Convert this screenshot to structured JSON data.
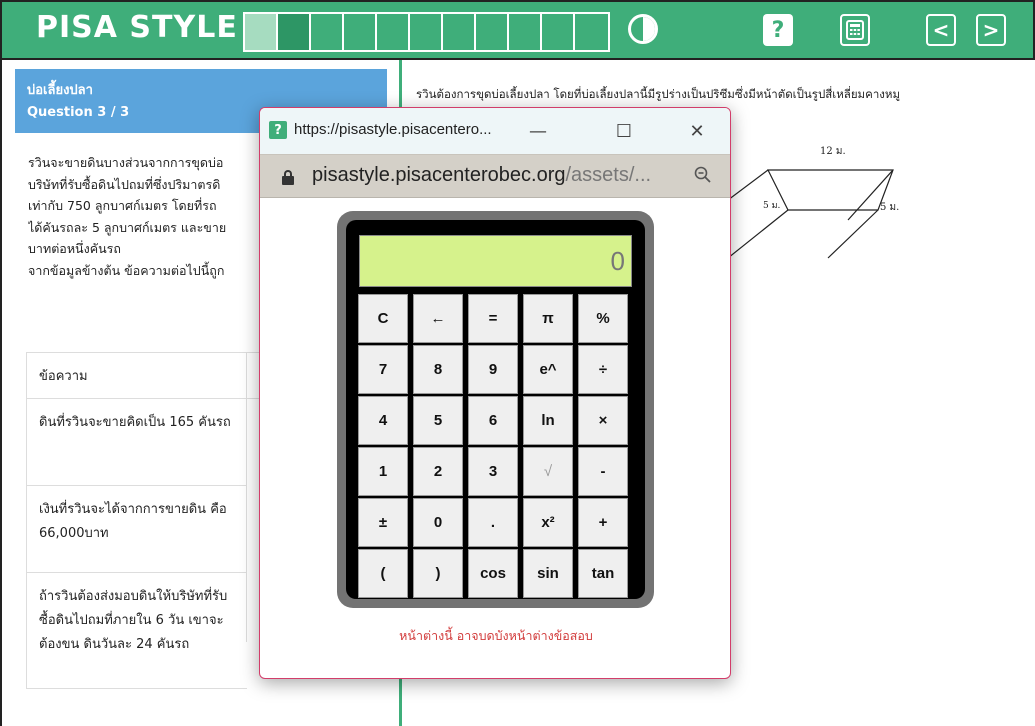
{
  "topbar": {
    "brand": "PISA STYLE",
    "progress": {
      "total": 11,
      "completed": 1,
      "current": 2
    },
    "icons": {
      "contrast": "contrast-icon",
      "help": "help-icon",
      "help_label": "?",
      "calculator": "calculator-icon",
      "prev": "chevron-left-icon",
      "next": "chevron-right-icon",
      "prev_label": "<",
      "next_label": ">"
    },
    "colors": {
      "brand_green": "#3fae7a",
      "header_blue": "#5ba4dc"
    }
  },
  "question": {
    "title": "บ่อเลี้ยงปลา",
    "number": "Question 3 / 3",
    "story_lines": [
      "รวินจะขายดินบางส่วนจากการขุดบ่อ",
      "บริษัทที่รับซื้อดินไปถมที่ซึ่งปริมาตรดิ",
      "เท่ากับ 750 ลูกบาศก์เมตร โดยที่รถ",
      "ได้คันรถละ 5 ลูกบาศก์เมตร และขาย",
      "บาทต่อหนึ่งคันรถ",
      "จากข้อมูลข้างต้น ข้อความต่อไปนี้ถูก"
    ],
    "table": {
      "header": "ข้อความ",
      "rows": [
        "ดินที่รวินจะขายคิดเป็น 165 คันรถ",
        "เงินที่รวินจะได้จากการขายดิน คือ 66,000บาท",
        "ถ้ารวินต้องส่งมอบดินให้บริษัทที่รับซื้อดินไปถมที่ภายใน 6 วัน เขาจะต้องขน ดินวันละ 24 คันรถ"
      ]
    }
  },
  "right": {
    "text_line1": "รวินต้องการขุดบ่อเลี้ยงปลา โดยที่บ่อเลี้ยงปลานี้มีรูปร่างเป็นปริซึมซึ่งมีหน้าตัดเป็นรูปสี่เหลี่ยมคางหมู",
    "diagram_labels": {
      "top": "12 ม.",
      "side_left": "5 ม.",
      "side_right": "5 ม."
    }
  },
  "popup": {
    "title": "https://pisastyle.pisacentero...",
    "icon": "pisa-help-icon",
    "minimize": "—",
    "maximize": "☐",
    "close": "✕",
    "url_domain": "pisastyle.pisacenterobec.org",
    "url_path": "/assets/...",
    "warning": "หน้าต่างนี้ อาจบดบังหน้าต่างข้อสอบ"
  },
  "calculator": {
    "display": "0",
    "keys": [
      [
        "C",
        "←",
        "=",
        "π",
        "%"
      ],
      [
        "7",
        "8",
        "9",
        "e^",
        "÷"
      ],
      [
        "4",
        "5",
        "6",
        "ln",
        "×"
      ],
      [
        "1",
        "2",
        "3",
        "√",
        "-"
      ],
      [
        "±",
        "0",
        ".",
        "x²",
        "+"
      ],
      [
        "(",
        ")",
        "cos",
        "sin",
        "tan"
      ]
    ],
    "key_names": [
      [
        "key-clear",
        "key-backspace",
        "key-equals",
        "key-pi",
        "key-percent"
      ],
      [
        "key-7",
        "key-8",
        "key-9",
        "key-exp",
        "key-divide"
      ],
      [
        "key-4",
        "key-5",
        "key-6",
        "key-ln",
        "key-multiply"
      ],
      [
        "key-1",
        "key-2",
        "key-3",
        "key-sqrt",
        "key-minus"
      ],
      [
        "key-plus-minus",
        "key-0",
        "key-decimal",
        "key-square",
        "key-plus"
      ],
      [
        "key-open-paren",
        "key-close-paren",
        "key-cos",
        "key-sin",
        "key-tan"
      ]
    ]
  }
}
